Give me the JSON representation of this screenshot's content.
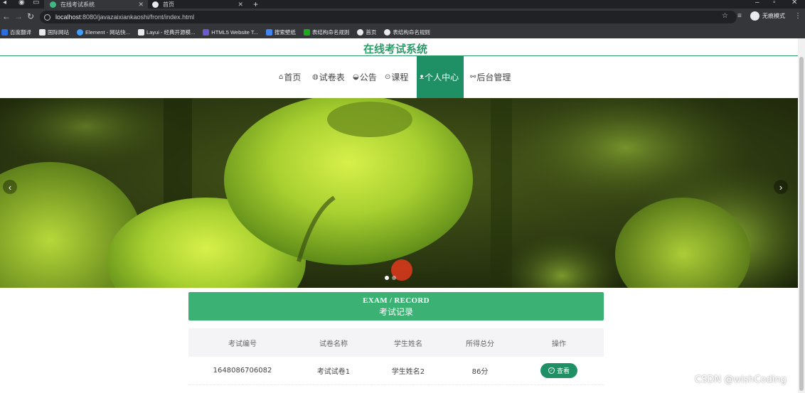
{
  "browser": {
    "tabs": [
      {
        "title": "在线考试系统",
        "icon_color": "#41b883"
      },
      {
        "title": "首页",
        "icon_color": "#e8eaed"
      }
    ],
    "url_host": "localhost",
    "url_rest": ":8080/javazaixiankaoshi/front/index.html",
    "incognito_label": "无痕模式",
    "bookmarks": [
      {
        "label": "百度翻译",
        "icon_color": "#2b6de2"
      },
      {
        "label": "国际网站",
        "icon_color": "#e8eaed"
      },
      {
        "label": "Element - 网站快...",
        "icon_color": "#409eff"
      },
      {
        "label": "Layui - 经典开源模...",
        "icon_color": "#e8eaed"
      },
      {
        "label": "HTML5 Website T...",
        "icon_color": "#6a5acd"
      },
      {
        "label": "搜索壁纸",
        "icon_color": "#4285f4"
      },
      {
        "label": "表结构命名规则",
        "icon_color": "#1aad19"
      },
      {
        "label": "首页",
        "icon_color": "#e8eaed"
      },
      {
        "label": "表结构命名规则",
        "icon_color": "#e8eaed"
      }
    ]
  },
  "site": {
    "title": "在线考试系统",
    "accent": "#1f8f66",
    "nav": [
      {
        "icon": "home-icon",
        "glyph": "⌂",
        "label": "首页"
      },
      {
        "icon": "paper-icon",
        "glyph": "◍",
        "label": "试卷表"
      },
      {
        "icon": "notice-icon",
        "glyph": "◒",
        "label": "公告"
      },
      {
        "icon": "course-icon",
        "glyph": "⊙",
        "label": "课程"
      },
      {
        "icon": "user-icon",
        "glyph": "ᴥ",
        "label": "个人中心",
        "active": true
      },
      {
        "icon": "link-icon",
        "glyph": "⚯",
        "label": "后台管理"
      }
    ]
  },
  "banner": {
    "prev_glyph": "‹",
    "next_glyph": "›",
    "slides": 2,
    "active_slide": 1
  },
  "section": {
    "title_en": "EXAM / RECORD",
    "title_cn": "考试记录"
  },
  "table": {
    "headers": [
      "考试编号",
      "试卷名称",
      "学生姓名",
      "所得总分",
      "操作"
    ],
    "rows": [
      {
        "id": "1648086706082",
        "paper": "考试试卷1",
        "student": "学生姓名2",
        "score": "86分",
        "action": "查看"
      }
    ]
  },
  "watermark": "CSDN @wishCoding"
}
